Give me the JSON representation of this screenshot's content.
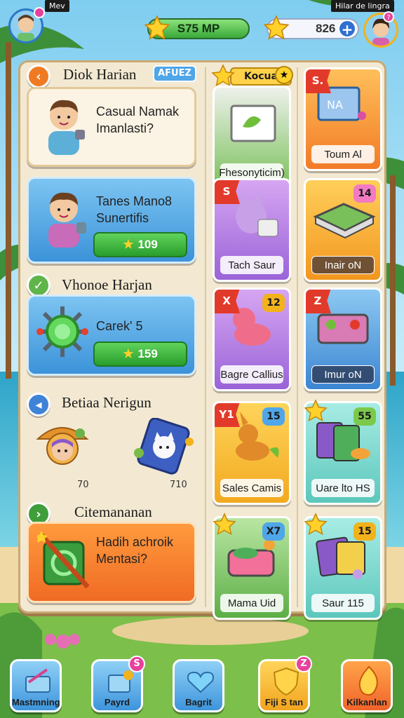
{
  "header": {
    "left_tag": "Mev",
    "right_tag": "Hilar de lingra",
    "left_avatar_badge": "",
    "right_avatar_badge": "?",
    "xp_value": "S75 MP",
    "coins_value": "826"
  },
  "left_column": {
    "section1": {
      "title": "Diok Harian",
      "badge": "AFUEZ",
      "card_text_line1": "Casual Namak",
      "card_text_line2": "Imanlasti?"
    },
    "card2": {
      "text_line1": "Tanes Mano8",
      "text_line2": "Sunertifis",
      "button_value": "109"
    },
    "section2": {
      "title": "Vhonoe Harjan",
      "card_text": "Carek' 5",
      "button_value": "159"
    },
    "section3": {
      "title": "Betiaa Nerigun",
      "item1_count": "70",
      "item2_count": "710"
    },
    "section4": {
      "title": "Citemananan",
      "card_text_line1": "Hadih achroik",
      "card_text_line2": "Mentasi?"
    }
  },
  "shop": {
    "header_label": "Kocua",
    "tiles": [
      {
        "label": "Fhesonyticim)",
        "corner": "",
        "ribbon": ""
      },
      {
        "label": "Toum Al",
        "corner": "",
        "ribbon": "S."
      },
      {
        "label": "Tach Saur",
        "corner": "",
        "ribbon": "S"
      },
      {
        "label": "Inair oN",
        "corner": "14",
        "ribbon": ""
      },
      {
        "label": "Bagre Callius",
        "corner": "12",
        "ribbon": "X"
      },
      {
        "label": "Imur oN",
        "corner": "",
        "ribbon": "Z"
      },
      {
        "label": "Sales Camis",
        "corner": "15",
        "ribbon": "Y1"
      },
      {
        "label": "Uare lto HS",
        "corner": "55",
        "ribbon": ""
      },
      {
        "label": "Mama Uid",
        "corner": "X7",
        "ribbon": ""
      },
      {
        "label": "Saur 115",
        "corner": "15",
        "ribbon": ""
      }
    ]
  },
  "bottom_nav": [
    {
      "label": "Mastmning",
      "badge": ""
    },
    {
      "label": "Payrd",
      "badge": "S"
    },
    {
      "label": "Bagrit",
      "badge": ""
    },
    {
      "label": "Fiji S tan",
      "badge": "Z"
    },
    {
      "label": "Kilkanlan",
      "badge": ""
    }
  ],
  "colors": {
    "panel": "#f3e9d2",
    "accent_green": "#39a93a",
    "accent_blue": "#3c93d9",
    "accent_orange": "#f06b24",
    "tile_purple": "#b77ee6",
    "tile_teal": "#7ed7d0"
  }
}
